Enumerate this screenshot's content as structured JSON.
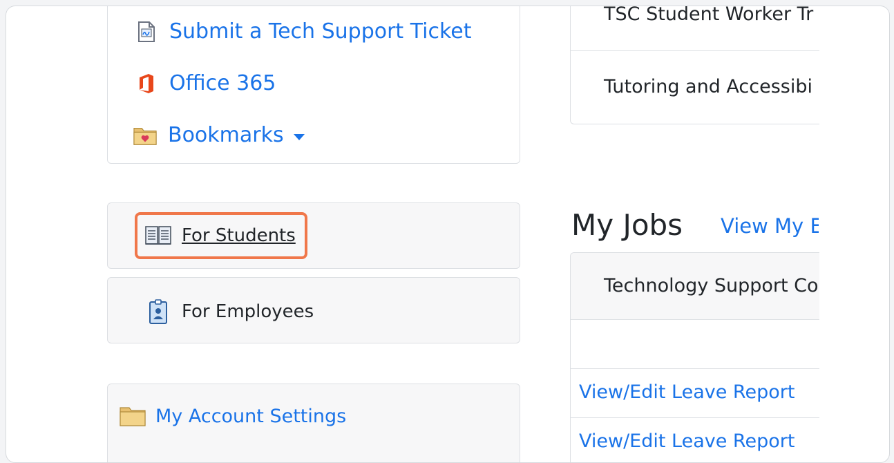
{
  "quick_links": {
    "tech_support": "Submit a Tech Support Ticket",
    "office365": "Office 365",
    "bookmarks": "Bookmarks"
  },
  "menu": {
    "students": "For Students",
    "employees": "For Employees",
    "account_settings": "My Account Settings"
  },
  "right_panel": {
    "item1": "TSC Student Worker Tr",
    "item2": "Tutoring and Accessibi"
  },
  "jobs": {
    "title": "My Jobs",
    "view_link": "View My E",
    "header": "Technology Support Co",
    "rows": [
      "View/Edit Leave Report",
      "View/Edit Leave Report"
    ]
  },
  "colors": {
    "link": "#1a73e8",
    "highlight": "#f0774a",
    "office": "#e8471b"
  }
}
